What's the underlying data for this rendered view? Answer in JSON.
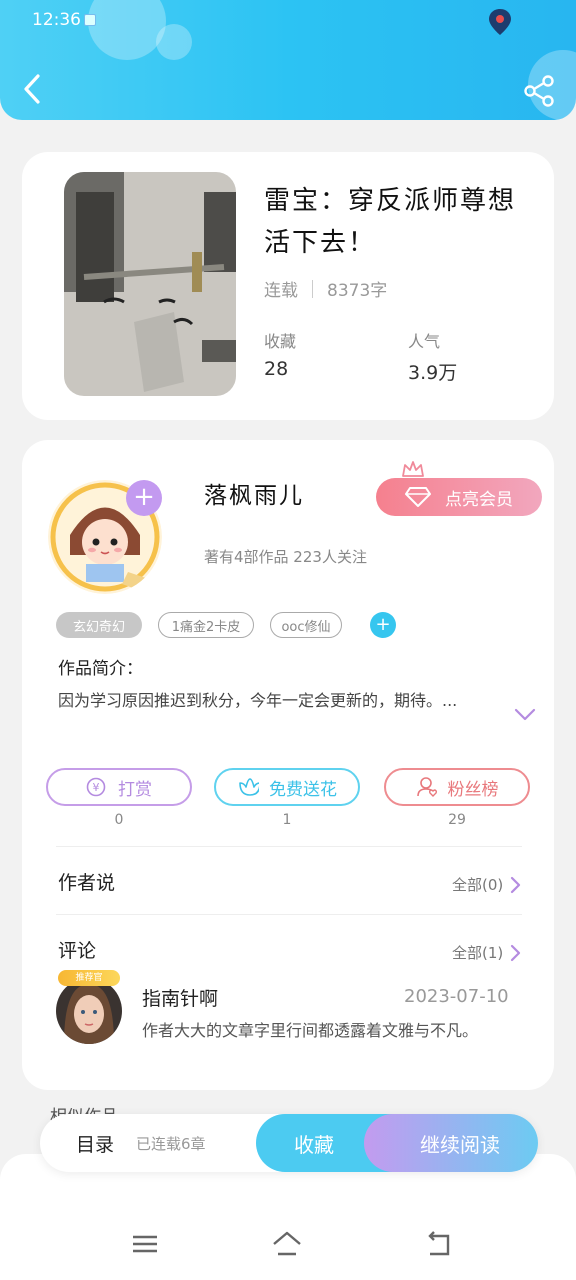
{
  "status_bar": {
    "time": "12:36"
  },
  "header": {
    "back_icon": "back-arrow-icon",
    "share_icon": "share-icon"
  },
  "book": {
    "title": "雷宝：穿反派师尊想活下去！",
    "status": "连载",
    "word_count": "8373字",
    "favorites_label": "收藏",
    "favorites_value": "28",
    "popularity_label": "人气",
    "popularity_value": "3.9万"
  },
  "author": {
    "name": "落枫雨儿",
    "member_button": "点亮会员",
    "stats": "著有4部作品 223人关注",
    "tags": [
      "玄幻奇幻",
      "1痛金2卡皮",
      "ooc修仙"
    ]
  },
  "intro": {
    "title": "作品简介：",
    "text": "因为学习原因推迟到秋分，今年一定会更新的，期待。..."
  },
  "actions": [
    {
      "label": "打赏",
      "count": "0",
      "icon": "yen-coin-icon",
      "color": "#c59de8"
    },
    {
      "label": "免费送花",
      "count": "1",
      "icon": "flower-icon",
      "color": "#5fd2ef"
    },
    {
      "label": "粉丝榜",
      "count": "29",
      "icon": "fan-user-icon",
      "color": "#ee8c90"
    }
  ],
  "author_says": {
    "title": "作者说",
    "more": "全部(0)"
  },
  "comments": {
    "title": "评论",
    "more": "全部(1)",
    "item": {
      "badge": "推荐官",
      "name": "指南针啊",
      "date": "2023-07-10",
      "text": "作者大大的文章字里行间都透露着文雅与不凡。"
    }
  },
  "similar_label": "相似作品",
  "bottom_bar": {
    "toc_label": "目录",
    "toc_count": "已连载6章",
    "favorite_button": "收藏",
    "read_button": "继续阅读"
  },
  "nav": {
    "menu_icon": "menu-icon",
    "home_icon": "home-icon",
    "back_icon": "back-icon"
  },
  "colors": {
    "header": "#2cc3f3",
    "accent_blue": "#4ccbf1",
    "accent_purple": "#c39bef",
    "member_pink": "#f5808e"
  }
}
